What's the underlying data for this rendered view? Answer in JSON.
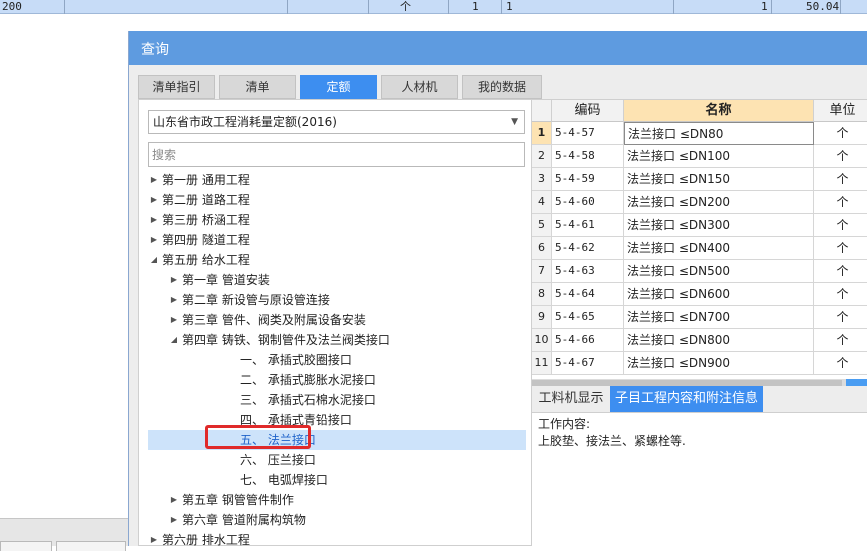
{
  "background_sheet": {
    "row": [
      "200",
      "个",
      "1",
      "1",
      "1",
      "50.04"
    ]
  },
  "dialog": {
    "title": "查询",
    "tabs": [
      "清单指引",
      "清单",
      "定额",
      "人材机",
      "我的数据"
    ],
    "active_tab": "定额",
    "library": "山东省市政工程消耗量定额(2016)",
    "search": {
      "placeholder": "搜索",
      "value": ""
    },
    "tree": [
      {
        "label": "第一册 通用工程",
        "toggle": "collapsed"
      },
      {
        "label": "第二册 道路工程",
        "toggle": "collapsed"
      },
      {
        "label": "第三册 桥涵工程",
        "toggle": "collapsed"
      },
      {
        "label": "第四册 隧道工程",
        "toggle": "collapsed"
      },
      {
        "label": "第五册 给水工程",
        "toggle": "expanded"
      },
      {
        "label": "第一章 管道安装",
        "toggle": "collapsed"
      },
      {
        "label": "第二章 新设管与原设管连接",
        "toggle": "collapsed"
      },
      {
        "label": "第三章 管件、阀类及附属设备安装",
        "toggle": "collapsed"
      },
      {
        "label": "第四章 铸铁、钢制管件及法兰阀类接口",
        "toggle": "expanded"
      },
      {
        "label": "一、  承插式胶圈接口",
        "toggle": "none"
      },
      {
        "label": "二、  承插式膨胀水泥接口",
        "toggle": "none"
      },
      {
        "label": "三、  承插式石棉水泥接口",
        "toggle": "none"
      },
      {
        "label": "四、  承插式青铅接口",
        "toggle": "none"
      },
      {
        "label": "五、  法兰接口",
        "toggle": "none",
        "selected": true
      },
      {
        "label": "六、  压兰接口",
        "toggle": "none"
      },
      {
        "label": "七、  电弧焊接口",
        "toggle": "none"
      },
      {
        "label": "第五章 钢管管件制作",
        "toggle": "collapsed"
      },
      {
        "label": "第六章 管道附属构筑物",
        "toggle": "collapsed"
      },
      {
        "label": "第六册 排水工程",
        "toggle": "collapsed"
      }
    ],
    "grid": {
      "columns": [
        "编码",
        "名称",
        "单位"
      ],
      "rows": [
        {
          "no": "1",
          "code": "5-4-57",
          "name": "法兰接口 ≤DN80",
          "unit": "个"
        },
        {
          "no": "2",
          "code": "5-4-58",
          "name": "法兰接口 ≤DN100",
          "unit": "个"
        },
        {
          "no": "3",
          "code": "5-4-59",
          "name": "法兰接口 ≤DN150",
          "unit": "个"
        },
        {
          "no": "4",
          "code": "5-4-60",
          "name": "法兰接口 ≤DN200",
          "unit": "个"
        },
        {
          "no": "5",
          "code": "5-4-61",
          "name": "法兰接口 ≤DN300",
          "unit": "个"
        },
        {
          "no": "6",
          "code": "5-4-62",
          "name": "法兰接口 ≤DN400",
          "unit": "个"
        },
        {
          "no": "7",
          "code": "5-4-63",
          "name": "法兰接口 ≤DN500",
          "unit": "个"
        },
        {
          "no": "8",
          "code": "5-4-64",
          "name": "法兰接口 ≤DN600",
          "unit": "个"
        },
        {
          "no": "9",
          "code": "5-4-65",
          "name": "法兰接口 ≤DN700",
          "unit": "个"
        },
        {
          "no": "10",
          "code": "5-4-66",
          "name": "法兰接口 ≤DN800",
          "unit": "个"
        },
        {
          "no": "11",
          "code": "5-4-67",
          "name": "法兰接口 ≤DN900",
          "unit": "个"
        }
      ]
    },
    "info_tabs": [
      "工料机显示",
      "子目工程内容和附注信息"
    ],
    "active_info_tab": "子目工程内容和附注信息",
    "info": {
      "heading": "工作内容:",
      "content": "上胶垫、接法兰、紧螺栓等."
    }
  },
  "colors": {
    "title_bar": "#5e9be0",
    "active_tab": "#3d8ef0",
    "selected_row": "#cde3fa",
    "highlight_box": "#e02a2a",
    "sorted_header": "#fde3b2"
  }
}
